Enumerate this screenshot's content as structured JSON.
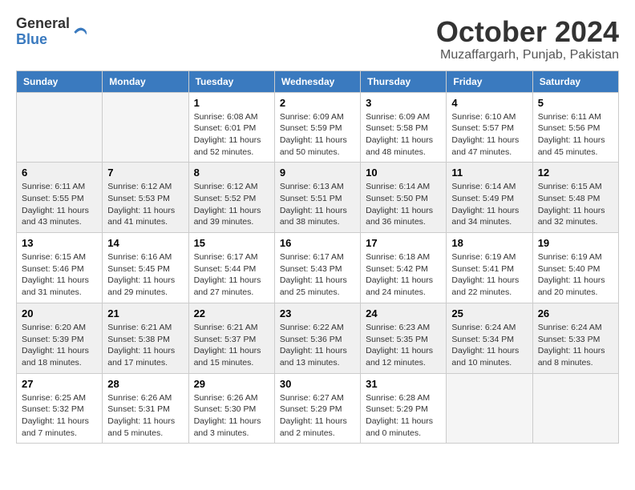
{
  "logo": {
    "general": "General",
    "blue": "Blue"
  },
  "header": {
    "month": "October 2024",
    "location": "Muzaffargarh, Punjab, Pakistan"
  },
  "days_of_week": [
    "Sunday",
    "Monday",
    "Tuesday",
    "Wednesday",
    "Thursday",
    "Friday",
    "Saturday"
  ],
  "weeks": [
    [
      {
        "day": "",
        "info": ""
      },
      {
        "day": "",
        "info": ""
      },
      {
        "day": "1",
        "info": "Sunrise: 6:08 AM\nSunset: 6:01 PM\nDaylight: 11 hours and 52 minutes."
      },
      {
        "day": "2",
        "info": "Sunrise: 6:09 AM\nSunset: 5:59 PM\nDaylight: 11 hours and 50 minutes."
      },
      {
        "day": "3",
        "info": "Sunrise: 6:09 AM\nSunset: 5:58 PM\nDaylight: 11 hours and 48 minutes."
      },
      {
        "day": "4",
        "info": "Sunrise: 6:10 AM\nSunset: 5:57 PM\nDaylight: 11 hours and 47 minutes."
      },
      {
        "day": "5",
        "info": "Sunrise: 6:11 AM\nSunset: 5:56 PM\nDaylight: 11 hours and 45 minutes."
      }
    ],
    [
      {
        "day": "6",
        "info": "Sunrise: 6:11 AM\nSunset: 5:55 PM\nDaylight: 11 hours and 43 minutes."
      },
      {
        "day": "7",
        "info": "Sunrise: 6:12 AM\nSunset: 5:53 PM\nDaylight: 11 hours and 41 minutes."
      },
      {
        "day": "8",
        "info": "Sunrise: 6:12 AM\nSunset: 5:52 PM\nDaylight: 11 hours and 39 minutes."
      },
      {
        "day": "9",
        "info": "Sunrise: 6:13 AM\nSunset: 5:51 PM\nDaylight: 11 hours and 38 minutes."
      },
      {
        "day": "10",
        "info": "Sunrise: 6:14 AM\nSunset: 5:50 PM\nDaylight: 11 hours and 36 minutes."
      },
      {
        "day": "11",
        "info": "Sunrise: 6:14 AM\nSunset: 5:49 PM\nDaylight: 11 hours and 34 minutes."
      },
      {
        "day": "12",
        "info": "Sunrise: 6:15 AM\nSunset: 5:48 PM\nDaylight: 11 hours and 32 minutes."
      }
    ],
    [
      {
        "day": "13",
        "info": "Sunrise: 6:15 AM\nSunset: 5:46 PM\nDaylight: 11 hours and 31 minutes."
      },
      {
        "day": "14",
        "info": "Sunrise: 6:16 AM\nSunset: 5:45 PM\nDaylight: 11 hours and 29 minutes."
      },
      {
        "day": "15",
        "info": "Sunrise: 6:17 AM\nSunset: 5:44 PM\nDaylight: 11 hours and 27 minutes."
      },
      {
        "day": "16",
        "info": "Sunrise: 6:17 AM\nSunset: 5:43 PM\nDaylight: 11 hours and 25 minutes."
      },
      {
        "day": "17",
        "info": "Sunrise: 6:18 AM\nSunset: 5:42 PM\nDaylight: 11 hours and 24 minutes."
      },
      {
        "day": "18",
        "info": "Sunrise: 6:19 AM\nSunset: 5:41 PM\nDaylight: 11 hours and 22 minutes."
      },
      {
        "day": "19",
        "info": "Sunrise: 6:19 AM\nSunset: 5:40 PM\nDaylight: 11 hours and 20 minutes."
      }
    ],
    [
      {
        "day": "20",
        "info": "Sunrise: 6:20 AM\nSunset: 5:39 PM\nDaylight: 11 hours and 18 minutes."
      },
      {
        "day": "21",
        "info": "Sunrise: 6:21 AM\nSunset: 5:38 PM\nDaylight: 11 hours and 17 minutes."
      },
      {
        "day": "22",
        "info": "Sunrise: 6:21 AM\nSunset: 5:37 PM\nDaylight: 11 hours and 15 minutes."
      },
      {
        "day": "23",
        "info": "Sunrise: 6:22 AM\nSunset: 5:36 PM\nDaylight: 11 hours and 13 minutes."
      },
      {
        "day": "24",
        "info": "Sunrise: 6:23 AM\nSunset: 5:35 PM\nDaylight: 11 hours and 12 minutes."
      },
      {
        "day": "25",
        "info": "Sunrise: 6:24 AM\nSunset: 5:34 PM\nDaylight: 11 hours and 10 minutes."
      },
      {
        "day": "26",
        "info": "Sunrise: 6:24 AM\nSunset: 5:33 PM\nDaylight: 11 hours and 8 minutes."
      }
    ],
    [
      {
        "day": "27",
        "info": "Sunrise: 6:25 AM\nSunset: 5:32 PM\nDaylight: 11 hours and 7 minutes."
      },
      {
        "day": "28",
        "info": "Sunrise: 6:26 AM\nSunset: 5:31 PM\nDaylight: 11 hours and 5 minutes."
      },
      {
        "day": "29",
        "info": "Sunrise: 6:26 AM\nSunset: 5:30 PM\nDaylight: 11 hours and 3 minutes."
      },
      {
        "day": "30",
        "info": "Sunrise: 6:27 AM\nSunset: 5:29 PM\nDaylight: 11 hours and 2 minutes."
      },
      {
        "day": "31",
        "info": "Sunrise: 6:28 AM\nSunset: 5:29 PM\nDaylight: 11 hours and 0 minutes."
      },
      {
        "day": "",
        "info": ""
      },
      {
        "day": "",
        "info": ""
      }
    ]
  ]
}
